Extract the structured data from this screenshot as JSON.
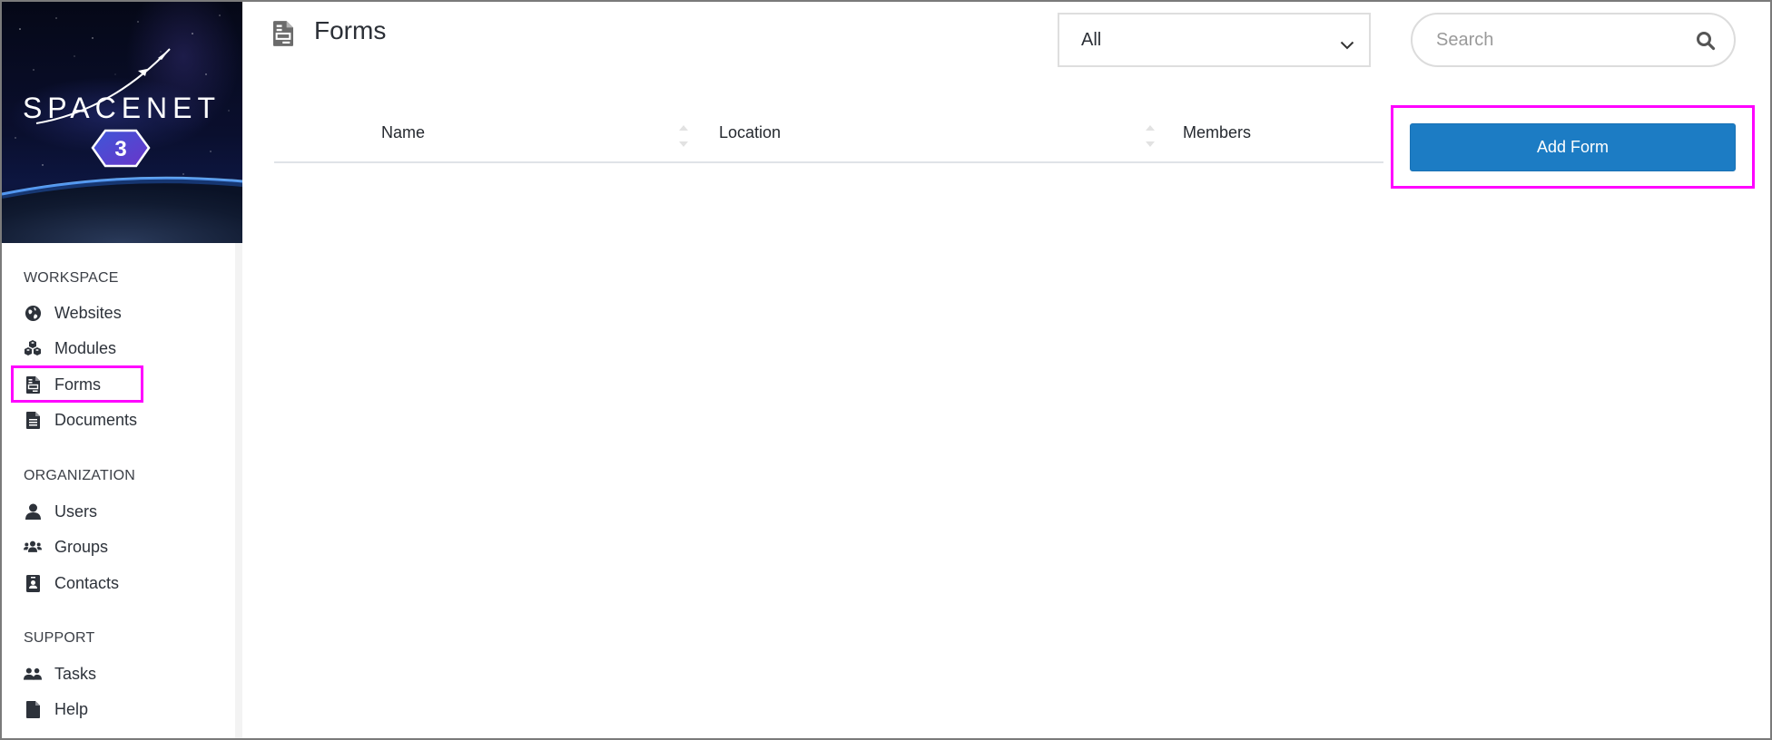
{
  "brand": {
    "logo_text": "SPACENET",
    "badge_text": "3",
    "colors": {
      "accent": "#1c7cc4",
      "highlight": "#ff00ff",
      "icon": "#2d323a"
    }
  },
  "sidebar": {
    "sections": [
      {
        "title": "WORKSPACE",
        "items": [
          {
            "label": "Websites",
            "icon": "globe-icon"
          },
          {
            "label": "Modules",
            "icon": "cubes-icon"
          },
          {
            "label": "Forms",
            "icon": "form-icon",
            "highlighted": true
          },
          {
            "label": "Documents",
            "icon": "document-icon"
          }
        ]
      },
      {
        "title": "ORGANIZATION",
        "items": [
          {
            "label": "Users",
            "icon": "user-icon"
          },
          {
            "label": "Groups",
            "icon": "users-icon"
          },
          {
            "label": "Contacts",
            "icon": "contact-card-icon"
          }
        ]
      },
      {
        "title": "SUPPORT",
        "items": [
          {
            "label": "Tasks",
            "icon": "user-group-icon"
          },
          {
            "label": "Help",
            "icon": "file-icon"
          }
        ]
      }
    ]
  },
  "header": {
    "title": "Forms",
    "icon": "form-icon",
    "filter": {
      "selected": "All"
    },
    "search": {
      "placeholder": "Search",
      "value": ""
    }
  },
  "table": {
    "columns": [
      {
        "label": "Name",
        "sortable": true
      },
      {
        "label": "Location",
        "sortable": true
      },
      {
        "label": "Members",
        "sortable": true
      }
    ],
    "rows": []
  },
  "actions": {
    "add_label": "Add Form"
  }
}
